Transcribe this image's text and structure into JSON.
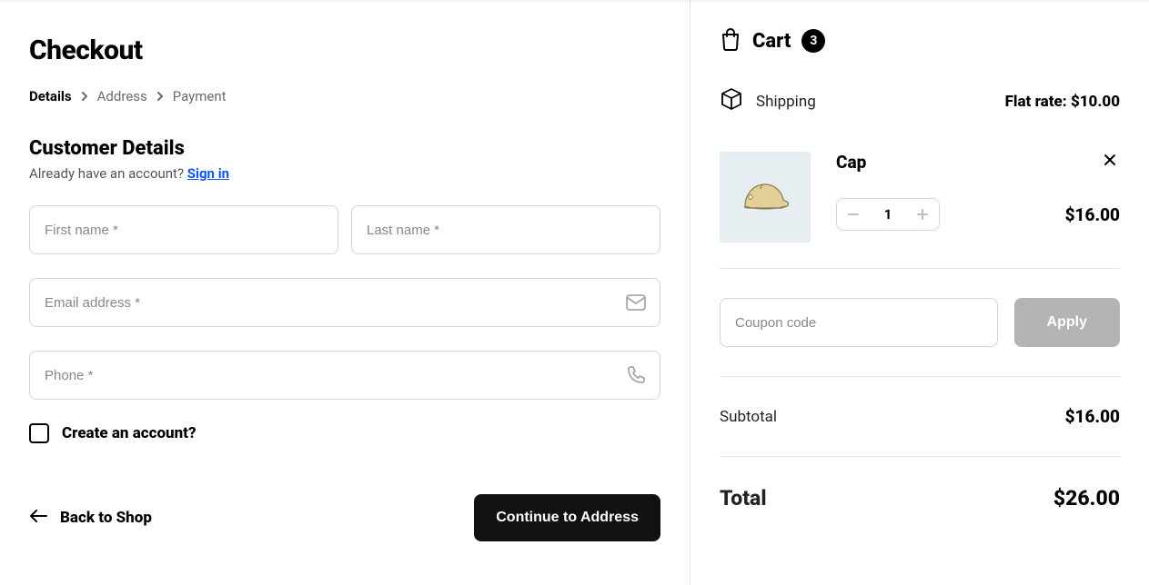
{
  "page_title": "Checkout",
  "breadcrumb": [
    "Details",
    "Address",
    "Payment"
  ],
  "breadcrumb_active_index": 0,
  "customer": {
    "section_title": "Customer Details",
    "account_prompt": "Already have an account? ",
    "signin_label": "Sign in",
    "fields": {
      "first_name_placeholder": "First name *",
      "last_name_placeholder": "Last name *",
      "email_placeholder": "Email address *",
      "phone_placeholder": "Phone *"
    },
    "create_account_label": "Create an account?"
  },
  "actions": {
    "back_label": "Back to Shop",
    "continue_label": "Continue to Address"
  },
  "cart": {
    "title": "Cart",
    "count": "3",
    "shipping_label": "Shipping",
    "shipping_value": "Flat rate: $10.00",
    "items": [
      {
        "name": "Cap",
        "qty": "1",
        "price": "$16.00"
      }
    ],
    "coupon_placeholder": "Coupon code",
    "apply_label": "Apply",
    "subtotal_label": "Subtotal",
    "subtotal_value": "$16.00",
    "total_label": "Total",
    "total_value": "$26.00"
  }
}
